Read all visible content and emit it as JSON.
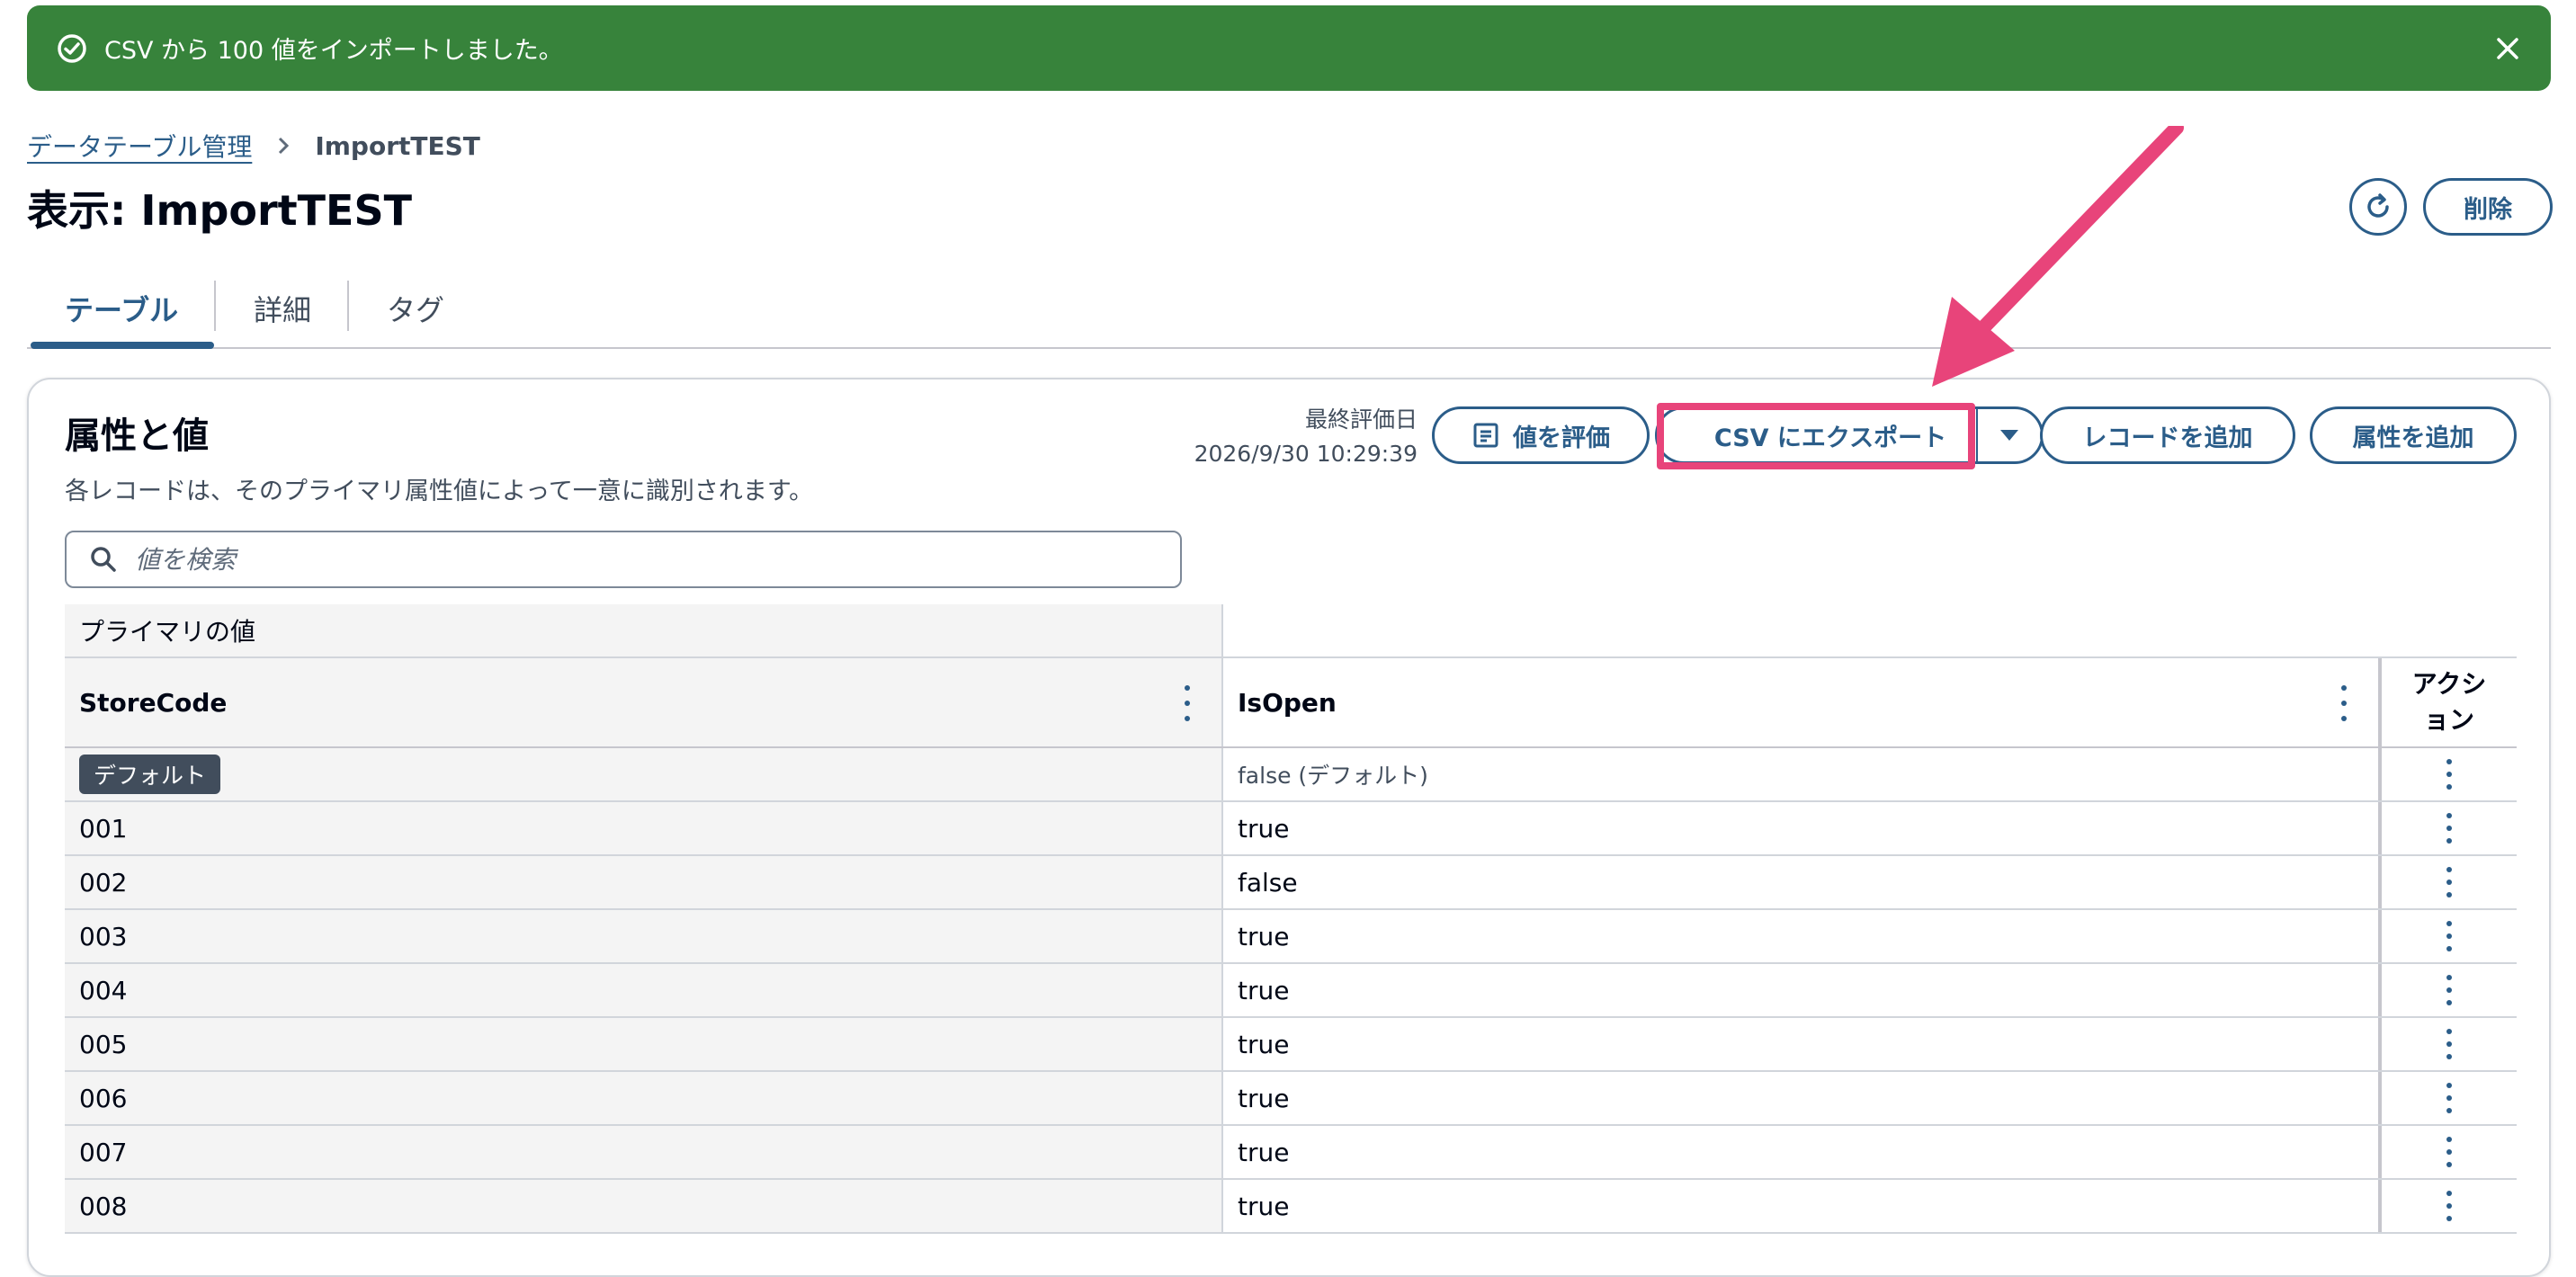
{
  "flash": {
    "message": "CSV から 100 値をインポートしました。"
  },
  "breadcrumb": {
    "parent": "データテーブル管理",
    "current": "ImportTEST"
  },
  "page": {
    "title": "表示: ImportTEST",
    "delete_label": "削除"
  },
  "tabs": [
    {
      "label": "テーブル"
    },
    {
      "label": "詳細"
    },
    {
      "label": "タグ"
    }
  ],
  "panel": {
    "title": "属性と値",
    "description": "各レコードは、そのプライマリ属性値によって一意に識別されます。",
    "last_eval_label": "最終評価日",
    "last_eval_value": "2026/9/30 10:29:39",
    "evaluate_label": "値を評価",
    "export_label": "CSV にエクスポート",
    "add_record_label": "レコードを追加",
    "add_attribute_label": "属性を追加"
  },
  "search": {
    "placeholder": "値を検索"
  },
  "table": {
    "group_header": "プライマリの値",
    "columns": [
      "StoreCode",
      "IsOpen",
      "アクション"
    ],
    "default_row": {
      "badge": "デフォルト",
      "value": "false (デフォルト)"
    },
    "rows": [
      {
        "code": "001",
        "value": "true"
      },
      {
        "code": "002",
        "value": "false"
      },
      {
        "code": "003",
        "value": "true"
      },
      {
        "code": "004",
        "value": "true"
      },
      {
        "code": "005",
        "value": "true"
      },
      {
        "code": "006",
        "value": "true"
      },
      {
        "code": "007",
        "value": "true"
      },
      {
        "code": "008",
        "value": "true"
      }
    ]
  },
  "colors": {
    "success": "#37833b",
    "accent": "#2b5d89",
    "annotation": "#e8447a"
  }
}
